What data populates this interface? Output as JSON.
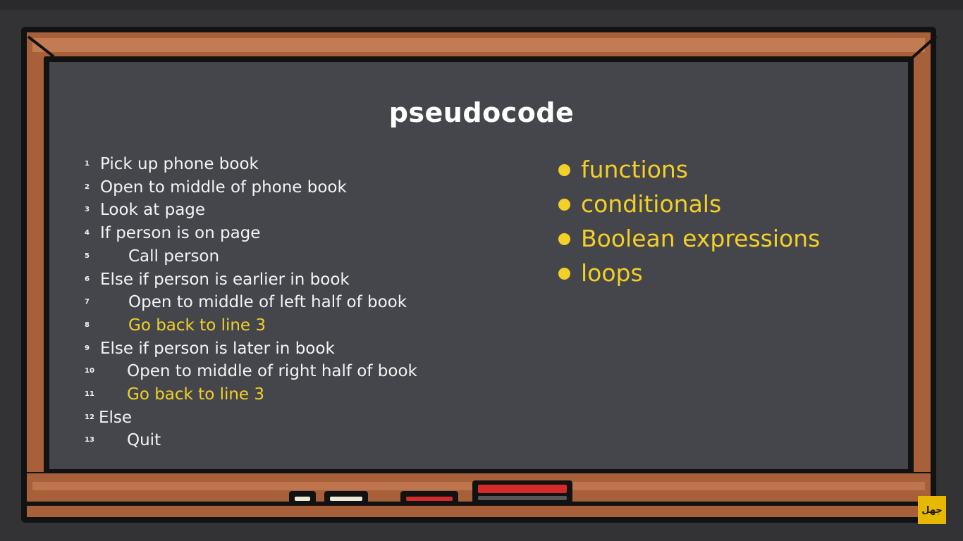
{
  "title": "pseudocode",
  "lines": [
    {
      "num": "1",
      "text": "Pick up phone book",
      "indent": 0,
      "highlight": false
    },
    {
      "num": "2",
      "text": "Open to middle of phone book",
      "indent": 0,
      "highlight": false
    },
    {
      "num": "3",
      "text": "Look at page",
      "indent": 0,
      "highlight": false
    },
    {
      "num": "4",
      "text": "If person is on page",
      "indent": 0,
      "highlight": false
    },
    {
      "num": "5",
      "text": "Call person",
      "indent": 1,
      "highlight": false
    },
    {
      "num": "6",
      "text": "Else if person is earlier in book",
      "indent": 0,
      "highlight": false
    },
    {
      "num": "7",
      "text": "Open to middle of left half of book",
      "indent": 1,
      "highlight": false
    },
    {
      "num": "8",
      "text": "Go back to line 3",
      "indent": 1,
      "highlight": true
    },
    {
      "num": "9",
      "text": "Else if person is later in book",
      "indent": 0,
      "highlight": false
    },
    {
      "num": "10",
      "text": "Open to middle of right half of book",
      "indent": 1,
      "highlight": false
    },
    {
      "num": "11",
      "text": "Go back to line 3",
      "indent": 1,
      "highlight": true
    },
    {
      "num": "12",
      "text": "Else",
      "indent": 0,
      "highlight": false
    },
    {
      "num": "13",
      "text": "Quit",
      "indent": 1,
      "highlight": false
    }
  ],
  "concepts": [
    "functions",
    "conditionals",
    "Boolean expressions",
    "loops"
  ],
  "logo_text": "جهل",
  "colors": {
    "board": "#45464c",
    "frame": "#a8603a",
    "highlight": "#f2d027",
    "text": "#f4f4f4"
  }
}
